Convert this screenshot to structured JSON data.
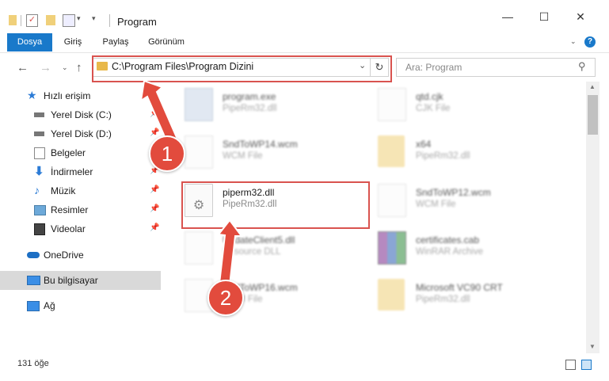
{
  "window": {
    "title": "Program",
    "minimize_glyph": "—",
    "maximize_glyph": "☐",
    "close_glyph": "✕"
  },
  "ribbon": {
    "tabs": [
      {
        "label": "Dosya"
      },
      {
        "label": "Giriş"
      },
      {
        "label": "Paylaş"
      },
      {
        "label": "Görünüm"
      }
    ],
    "help_glyph": "?"
  },
  "address": {
    "path": "C:\\Program Files\\Program Dizini",
    "search_placeholder": "Ara: Program"
  },
  "nav": {
    "items": [
      {
        "label": "Hızlı erişim",
        "icon": "star-icon"
      },
      {
        "label": "Yerel Disk (C:)",
        "icon": "drive-icon"
      },
      {
        "label": "Yerel Disk (D:)",
        "icon": "drive-icon"
      },
      {
        "label": "Belgeler",
        "icon": "documents-icon"
      },
      {
        "label": "İndirmeler",
        "icon": "download-icon"
      },
      {
        "label": "Müzik",
        "icon": "music-icon"
      },
      {
        "label": "Resimler",
        "icon": "pictures-icon"
      },
      {
        "label": "Videolar",
        "icon": "video-icon"
      },
      {
        "label": "OneDrive",
        "icon": "cloud-icon"
      },
      {
        "label": "Bu bilgisayar",
        "icon": "computer-icon"
      },
      {
        "label": "Ağ",
        "icon": "network-icon"
      }
    ]
  },
  "files": {
    "left": [
      {
        "name": "program.exe",
        "desc": "PipeRm32.dll"
      },
      {
        "name": "SndToWP14.wcm",
        "desc": "WCM File"
      },
      {
        "name": "piperm32.dll",
        "desc": "PipeRm32.dll"
      },
      {
        "name": "UpdateClient5.dll",
        "desc": "Resource DLL"
      },
      {
        "name": "SndToWP16.wcm",
        "desc": "WCM File"
      }
    ],
    "right": [
      {
        "name": "qtd.cjk",
        "desc": "CJK File"
      },
      {
        "name": "x64",
        "desc": "PipeRm32.dll"
      },
      {
        "name": "SndToWP12.wcm",
        "desc": "WCM File"
      },
      {
        "name": "certificates.cab",
        "desc": "WinRAR Archive"
      },
      {
        "name": "Microsoft VC90 CRT",
        "desc": "PipeRm32.dll"
      }
    ]
  },
  "status": {
    "count": "131 öğe"
  },
  "annotations": {
    "step1": "1",
    "step2": "2"
  },
  "colors": {
    "accent": "#1979ca",
    "annotation_red": "#e24b3d",
    "selected_nav": "#d9d9d9"
  }
}
